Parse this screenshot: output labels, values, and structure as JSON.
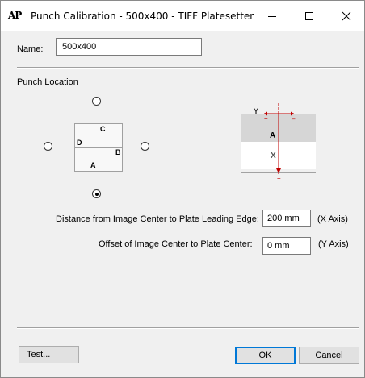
{
  "titlebar": {
    "app_icon_text": "AP",
    "title": "Punch Calibration - 500x400 - TIFF Platesetter",
    "icons": [
      "minimize-icon",
      "maximize-icon",
      "close-icon"
    ]
  },
  "name": {
    "label": "Name:",
    "value": "500x400"
  },
  "punch_location": {
    "label": "Punch Location",
    "selected": "bottom",
    "quadrants": {
      "c": "C",
      "d": "D",
      "b": "B",
      "a": "A"
    }
  },
  "diagram": {
    "y": "Y",
    "a": "A",
    "x": "X",
    "plus": "+",
    "minus": "–"
  },
  "distance": {
    "label": "Distance from Image Center to Plate Leading Edge:",
    "value": "200 mm",
    "axis": "(X Axis)"
  },
  "offset": {
    "label": "Offset of Image Center to Plate Center:",
    "value": "0 mm",
    "axis": "(Y Axis)"
  },
  "buttons": {
    "test": "Test...",
    "ok": "OK",
    "cancel": "Cancel"
  }
}
